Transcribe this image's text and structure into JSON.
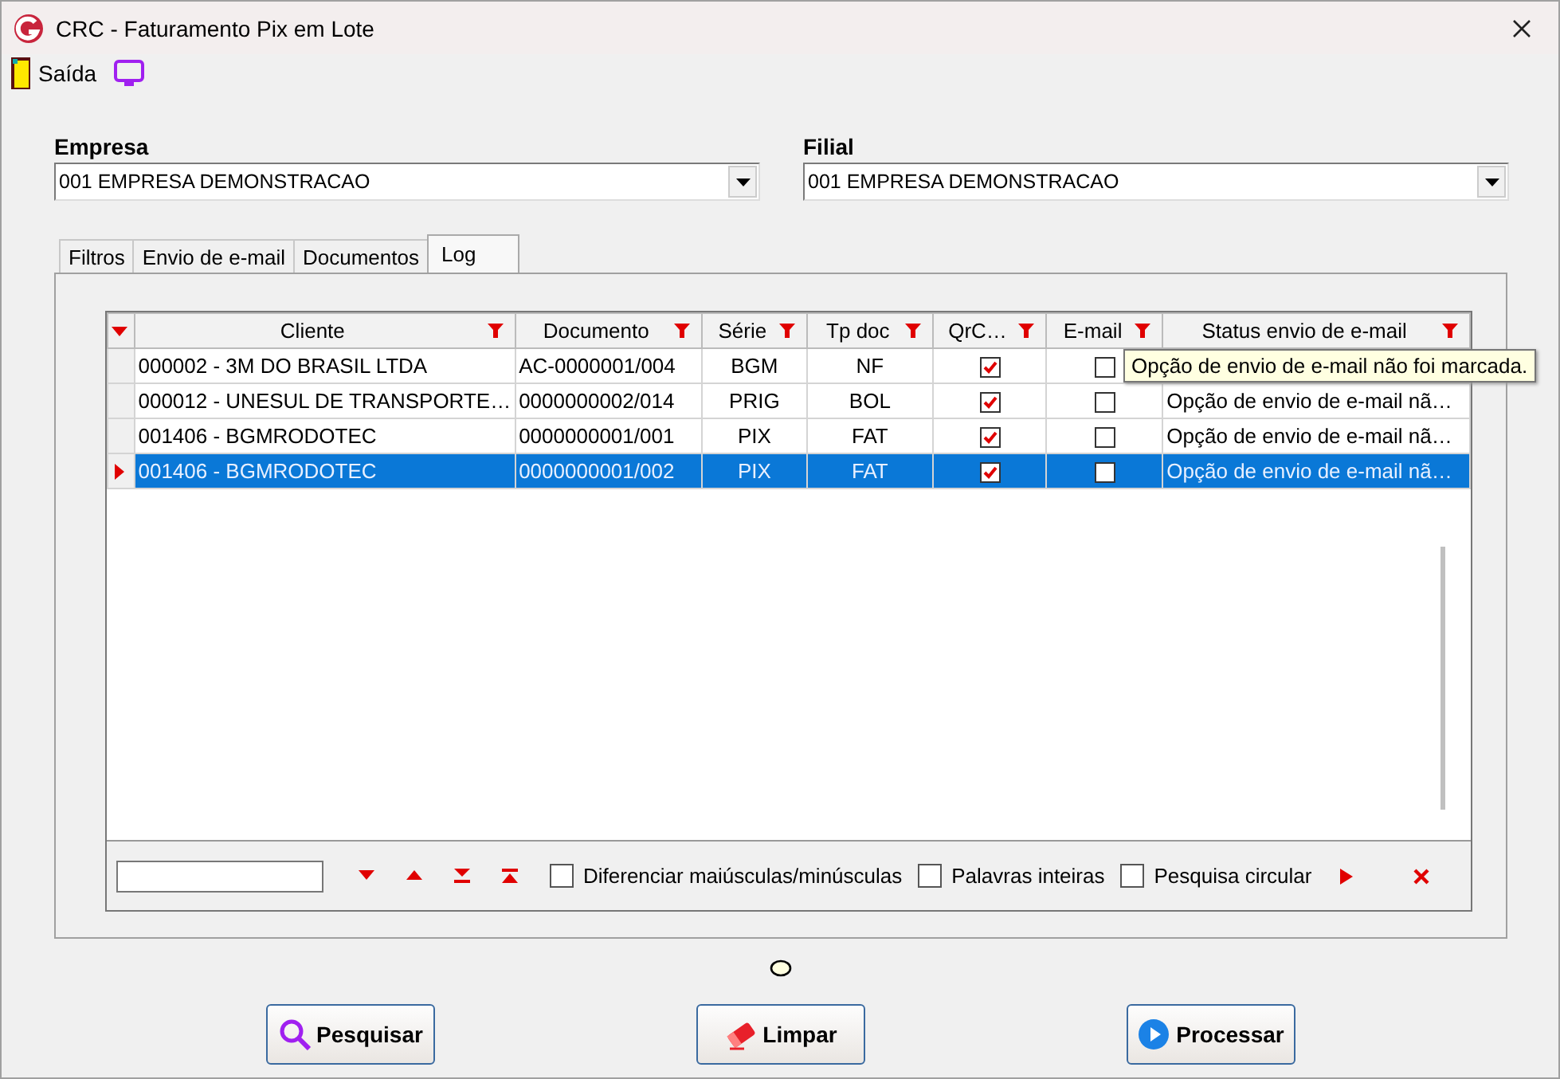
{
  "window": {
    "title": "CRC - Faturamento Pix em Lote"
  },
  "toolbar": [
    {
      "label": "Saída",
      "kind": "door"
    },
    {
      "kind": "monitor"
    }
  ],
  "fields": [
    {
      "label": "Empresa",
      "value": "001 EMPRESA DEMONSTRACAO"
    },
    {
      "label": "Filial",
      "value": "001 EMPRESA DEMONSTRACAO"
    }
  ],
  "tabs": [
    {
      "label": "Filtros",
      "selected": false
    },
    {
      "label": "Envio de e-mail",
      "selected": false
    },
    {
      "label": "Documentos",
      "selected": false
    },
    {
      "label": "Log",
      "selected": true
    }
  ],
  "table": {
    "columns": [
      "Cliente",
      "Documento",
      "Série",
      "Tp doc",
      "QrC…",
      "E-mail",
      "Status envio de e-mail"
    ],
    "rows": [
      {
        "cliente": "000002 - 3M DO BRASIL LTDA",
        "documento": "AC-0000001/004",
        "serie": "BGM",
        "tp_doc": "NF",
        "qrcode": true,
        "email": false,
        "selected": false
      },
      {
        "cliente": "000012 - UNESUL DE TRANSPORTE…",
        "documento": "0000000002/014",
        "serie": "PRIG",
        "tp_doc": "BOL",
        "qrcode": true,
        "email": false,
        "status": "Opção de envio de e-mail nã…",
        "selected": false
      },
      {
        "cliente": "001406 - BGMRODOTEC",
        "documento": "0000000001/001",
        "serie": "PIX",
        "tp_doc": "FAT",
        "qrcode": true,
        "email": false,
        "status": "Opção de envio de e-mail nã…",
        "selected": false
      },
      {
        "cliente": "001406 - BGMRODOTEC",
        "documento": "0000000001/002",
        "serie": "PIX",
        "tp_doc": "FAT",
        "qrcode": true,
        "email": false,
        "status": "Opção de envio de e-mail nã…",
        "selected": true
      }
    ],
    "tooltip": "Opção de envio de e-mail não foi marcada."
  },
  "find_bar": {
    "options": [
      {
        "label": "Diferenciar maiúsculas/minúsculas",
        "checked": false
      },
      {
        "label": "Palavras inteiras",
        "checked": false
      },
      {
        "label": "Pesquisa circular",
        "checked": false
      }
    ]
  },
  "buttons": [
    {
      "label": "Pesquisar",
      "kind": "search"
    },
    {
      "label": "Limpar",
      "kind": "eraser"
    },
    {
      "label": "Processar",
      "kind": "play"
    }
  ]
}
